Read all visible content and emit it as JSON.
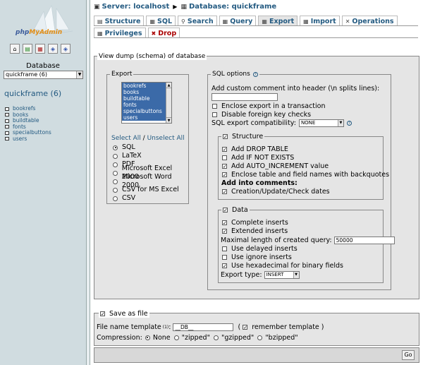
{
  "left": {
    "logo_text_php": "php",
    "logo_text_my": "MyAdmin",
    "database_label": "Database",
    "database_selected": "quickframe (6)",
    "current_db": "quickframe (6)",
    "tables": [
      "bookrefs",
      "books",
      "buildtable",
      "fonts",
      "specialbuttons",
      "users"
    ]
  },
  "breadcrumb": {
    "server": "Server: localhost",
    "database": "Database: quickframe"
  },
  "tabs": [
    {
      "label": "Structure",
      "icon": "structure-icon"
    },
    {
      "label": "SQL",
      "icon": "sql-icon"
    },
    {
      "label": "Search",
      "icon": "search-icon"
    },
    {
      "label": "Query",
      "icon": "query-icon"
    },
    {
      "label": "Export",
      "icon": "export-icon",
      "active": true
    },
    {
      "label": "Import",
      "icon": "import-icon"
    },
    {
      "label": "Operations",
      "icon": "operations-icon"
    },
    {
      "label": "Privileges",
      "icon": "privileges-icon"
    },
    {
      "label": "Drop",
      "icon": "drop-icon"
    }
  ],
  "main": {
    "legend": "View dump (schema) of database",
    "export": {
      "legend": "Export",
      "tables": [
        "bookrefs",
        "books",
        "buildtable",
        "fonts",
        "specialbuttons",
        "users"
      ],
      "select_all": "Select All",
      "slash": " / ",
      "unselect_all": "Unselect All",
      "formats": [
        "SQL",
        "LaTeX",
        "PDF",
        "Microsoft Excel 2000",
        "Microsoft Word 2000",
        "CSV for MS Excel",
        "CSV"
      ],
      "selected_format": "SQL"
    },
    "sql_options": {
      "legend": "SQL options",
      "comment_label": "Add custom comment into header (\\n splits lines):",
      "comment_value": "",
      "enclose_transaction": "Enclose export in a transaction",
      "disable_fk": "Disable foreign key checks",
      "compat_label": "SQL export compatibility:",
      "compat_value": "NONE",
      "structure": {
        "legend": "Structure",
        "add_drop": "Add DROP TABLE",
        "add_if_not_exists": "Add IF NOT EXISTS",
        "add_auto_increment": "Add AUTO_INCREMENT value",
        "enclose_backquotes": "Enclose table and field names with backquotes",
        "add_into_comments": "Add into comments:",
        "creation_dates": "Creation/Update/Check dates"
      },
      "data": {
        "legend": "Data",
        "complete_inserts": "Complete inserts",
        "extended_inserts": "Extended inserts",
        "max_length_label": "Maximal length of created query:",
        "max_length_value": "50000",
        "delayed_inserts": "Use delayed inserts",
        "ignore_inserts": "Use ignore inserts",
        "hex_binary": "Use hexadecimal for binary fields",
        "export_type_label": "Export type:",
        "export_type_value": "INSERT"
      }
    }
  },
  "saveas": {
    "legend": "Save as file",
    "template_label": "File name template",
    "template_sup": "(1)",
    "template_colon": ":",
    "template_value": "__DB__",
    "remember_open": "(",
    "remember_label": "remember template )",
    "compression_label": "Compression:",
    "compression_options": [
      "None",
      "\"zipped\"",
      "\"gzipped\"",
      "\"bzipped\""
    ],
    "compression_selected": "None"
  },
  "go_label": "Go",
  "colors": {
    "link": "#235a81",
    "active_tab": "#e5e5e5",
    "sidebar": "#d0dce0",
    "selection": "#3b6aa8"
  }
}
